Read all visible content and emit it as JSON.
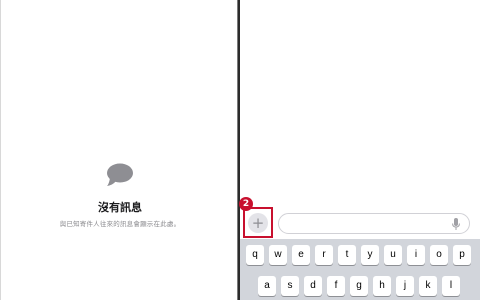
{
  "empty_state": {
    "icon": "message-bubble-icon",
    "title": "沒有訊息",
    "subtitle": "與已知寄件人往來的訊息會顯示在此處。"
  },
  "compose": {
    "plus_label": "+",
    "step_badge": "2",
    "highlight_color": "#c8102e",
    "mic_icon": "microphone-icon"
  },
  "keyboard": {
    "row1": [
      "q",
      "w",
      "e",
      "r",
      "t",
      "y",
      "u",
      "i",
      "o",
      "p"
    ],
    "row2": [
      "a",
      "s",
      "d",
      "f",
      "g",
      "h",
      "j",
      "k",
      "l"
    ]
  }
}
